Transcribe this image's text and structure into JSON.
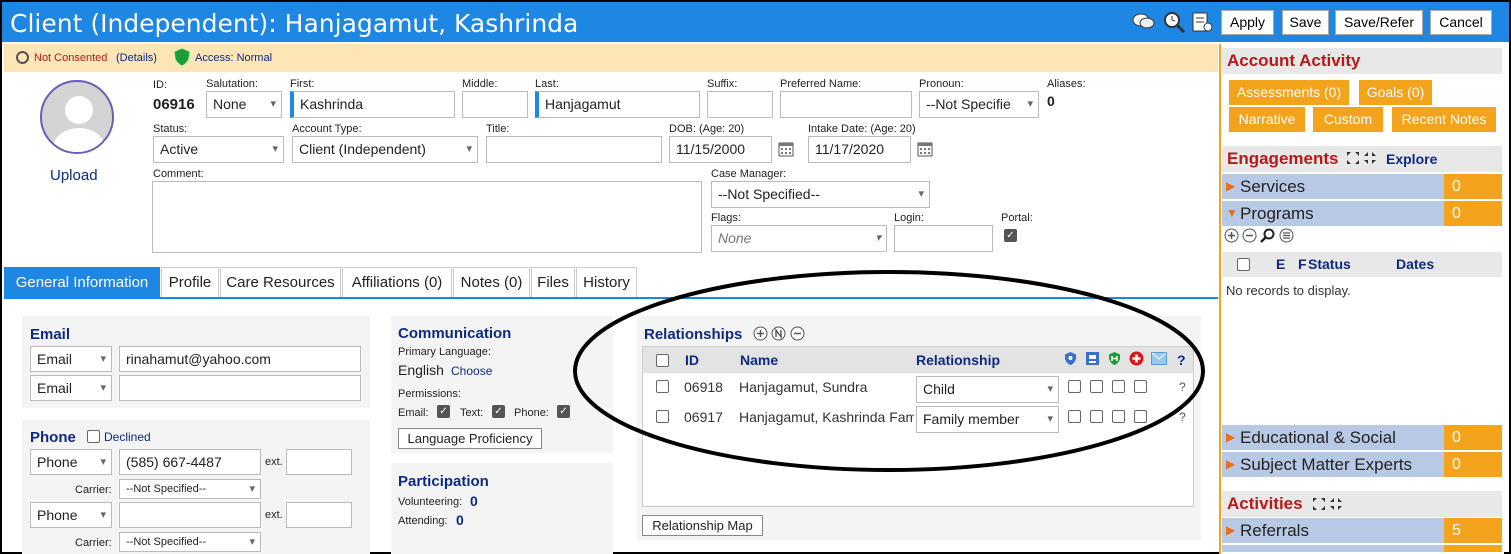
{
  "header": {
    "title": "Client (Independent): Hanjagamut, Kashrinda",
    "apply": "Apply",
    "save": "Save",
    "save_refer": "Save/Refer",
    "cancel": "Cancel"
  },
  "consent": {
    "status": "Not Consented",
    "details": "(Details)",
    "access": "Access: Normal"
  },
  "photo": {
    "upload": "Upload"
  },
  "fields": {
    "id_label": "ID:",
    "id_value": "06916",
    "salutation_label": "Salutation:",
    "salutation": "None",
    "first_label": "First:",
    "first": "Kashrinda",
    "middle_label": "Middle:",
    "middle": "",
    "last_label": "Last:",
    "last": "Hanjagamut",
    "suffix_label": "Suffix:",
    "suffix": "",
    "preferred_label": "Preferred Name:",
    "preferred": "",
    "pronoun_label": "Pronoun:",
    "pronoun": "--Not Specifie",
    "aliases_label": "Aliases:",
    "aliases": "0",
    "status_label": "Status:",
    "status": "Active",
    "account_type_label": "Account Type:",
    "account_type": "Client (Independent)",
    "title_label": "Title:",
    "title": "",
    "dob_label": "DOB: (Age: 20)",
    "dob": "11/15/2000",
    "intake_label": "Intake Date: (Age: 20)",
    "intake": "11/17/2020",
    "comment_label": "Comment:",
    "comment": "",
    "case_manager_label": "Case Manager:",
    "case_manager": "--Not Specified--",
    "flags_label": "Flags:",
    "flags": "None",
    "login_label": "Login:",
    "login": "",
    "portal_label": "Portal:"
  },
  "tabs": [
    "General Information",
    "Profile",
    "Care Resources",
    "Affiliations (0)",
    "Notes (0)",
    "Files",
    "History"
  ],
  "email": {
    "header": "Email",
    "rows": [
      {
        "type": "Email",
        "value": "rinahamut@yahoo.com"
      },
      {
        "type": "Email",
        "value": ""
      }
    ]
  },
  "phone": {
    "header": "Phone",
    "declined": "Declined",
    "ext_label": "ext.",
    "carrier_label": "Carrier:",
    "rows": [
      {
        "type": "Phone",
        "value": "(585) 667-4487",
        "carrier": "--Not Specified--"
      },
      {
        "type": "Phone",
        "value": "",
        "carrier": "--Not Specified--"
      }
    ]
  },
  "communication": {
    "header": "Communication",
    "primary_language_label": "Primary Language:",
    "language": "English",
    "choose": "Choose",
    "permissions_label": "Permissions:",
    "email": "Email:",
    "text": "Text:",
    "phone": "Phone:",
    "proficiency_button": "Language Proficiency"
  },
  "participation": {
    "header": "Participation",
    "volunteering_label": "Volunteering:",
    "volunteering": "0",
    "attending_label": "Attending:",
    "attending": "0"
  },
  "relationships": {
    "header": "Relationships",
    "col_id": "ID",
    "col_name": "Name",
    "col_relationship": "Relationship",
    "q": "?",
    "map_button": "Relationship Map",
    "rows": [
      {
        "id": "06918",
        "name": "Hanjagamut, Sundra",
        "relationship": "Child"
      },
      {
        "id": "06917",
        "name": "Hanjagamut, Kashrinda Fam",
        "relationship": "Family member"
      }
    ]
  },
  "sidebar": {
    "account_activity": "Account Activity",
    "buttons": [
      "Assessments (0)",
      "Goals (0)",
      "Narrative",
      "Custom",
      "Recent Notes"
    ],
    "engagements": "Engagements",
    "explore": "Explore",
    "services": "Services",
    "services_count": "0",
    "programs": "Programs",
    "programs_count": "0",
    "prog_cols": [
      "E",
      "F",
      "Status",
      "Dates"
    ],
    "no_records": "No records to display.",
    "educational": "Educational & Social",
    "educational_count": "0",
    "sme": "Subject Matter Experts",
    "sme_count": "0",
    "activities": "Activities",
    "referrals": "Referrals",
    "referrals_count": "5"
  },
  "colors": {
    "accent": "#1e86e3",
    "orange": "#f3a31c",
    "section_red": "#b41a1a",
    "navy": "#0d2a80"
  }
}
